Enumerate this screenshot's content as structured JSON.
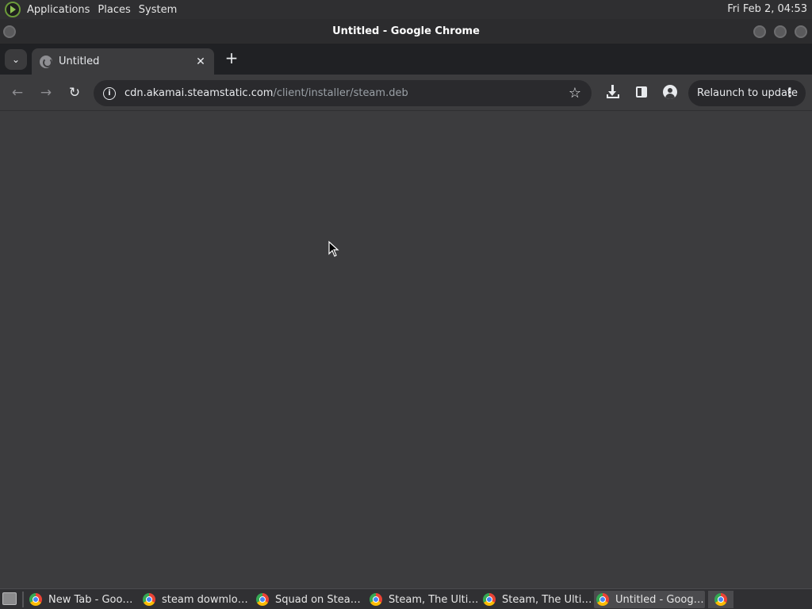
{
  "top_panel": {
    "menus": [
      "Applications",
      "Places",
      "System"
    ],
    "clock": "Fri Feb  2, 04:53"
  },
  "window": {
    "title": "Untitled - Google Chrome"
  },
  "browser": {
    "tab_title": "Untitled",
    "tab_close": "✕",
    "new_tab": "+",
    "url_host": "cdn.akamai.steamstatic.com",
    "url_path": "/client/installer/steam.deb",
    "relaunch_label": "Relaunch to update"
  },
  "taskbar": {
    "tasks": [
      {
        "label": "New Tab - Goo…",
        "active": false
      },
      {
        "label": "steam dowmlo…",
        "active": false
      },
      {
        "label": "Squad on Stea…",
        "active": false
      },
      {
        "label": "Steam, The Ulti…",
        "active": false
      },
      {
        "label": "Steam, The Ulti…",
        "active": false
      },
      {
        "label": "Untitled - Goog…",
        "active": true
      }
    ]
  },
  "colors": {
    "page_bg": "#3c3c3e",
    "tabstrip_bg": "#202124",
    "panel_bg": "#2f2f31"
  }
}
